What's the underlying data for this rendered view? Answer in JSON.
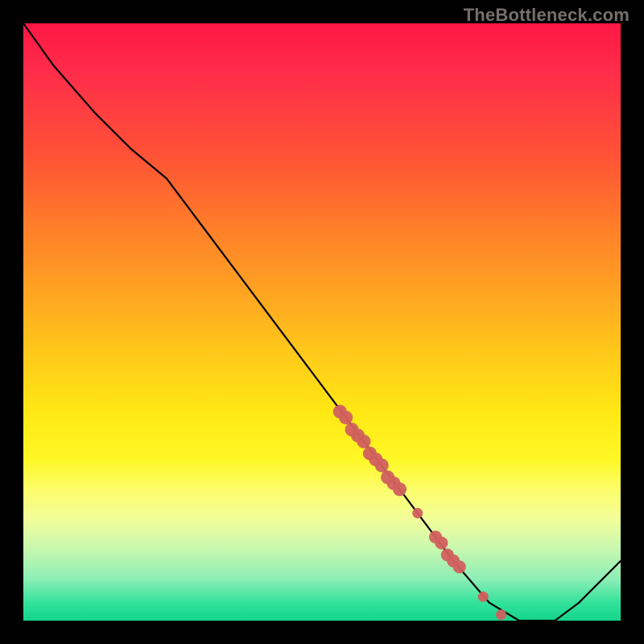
{
  "watermark": "TheBottleneck.com",
  "chart_data": {
    "type": "line",
    "title": "",
    "xlabel": "",
    "ylabel": "",
    "xlim": [
      0,
      100
    ],
    "ylim": [
      0,
      100
    ],
    "grid": false,
    "legend": false,
    "background_gradient": {
      "top": "#ff1744",
      "middle": "#ffe814",
      "bottom": "#14d48b"
    },
    "series": [
      {
        "name": "bottleneck-curve",
        "color": "#000000",
        "x": [
          0,
          5,
          12,
          18,
          24,
          30,
          36,
          42,
          48,
          54,
          60,
          66,
          72,
          78,
          83,
          86,
          89,
          93,
          100
        ],
        "y": [
          100,
          93,
          85,
          79,
          74,
          66,
          58,
          50,
          42,
          34,
          26,
          18,
          10,
          3,
          0,
          0,
          0,
          3,
          10
        ]
      }
    ],
    "markers": {
      "name": "highlight-dots",
      "color": "#d1605e",
      "points": [
        {
          "x": 53,
          "y": 35
        },
        {
          "x": 54,
          "y": 34
        },
        {
          "x": 55,
          "y": 32
        },
        {
          "x": 56,
          "y": 31
        },
        {
          "x": 57,
          "y": 30
        },
        {
          "x": 58,
          "y": 28
        },
        {
          "x": 59,
          "y": 27
        },
        {
          "x": 60,
          "y": 26
        },
        {
          "x": 61,
          "y": 24
        },
        {
          "x": 62,
          "y": 23
        },
        {
          "x": 63,
          "y": 22
        },
        {
          "x": 66,
          "y": 18
        },
        {
          "x": 69,
          "y": 14
        },
        {
          "x": 70,
          "y": 13
        },
        {
          "x": 71,
          "y": 11
        },
        {
          "x": 72,
          "y": 10
        },
        {
          "x": 73,
          "y": 9
        },
        {
          "x": 77,
          "y": 4
        },
        {
          "x": 80,
          "y": 1
        }
      ]
    }
  }
}
